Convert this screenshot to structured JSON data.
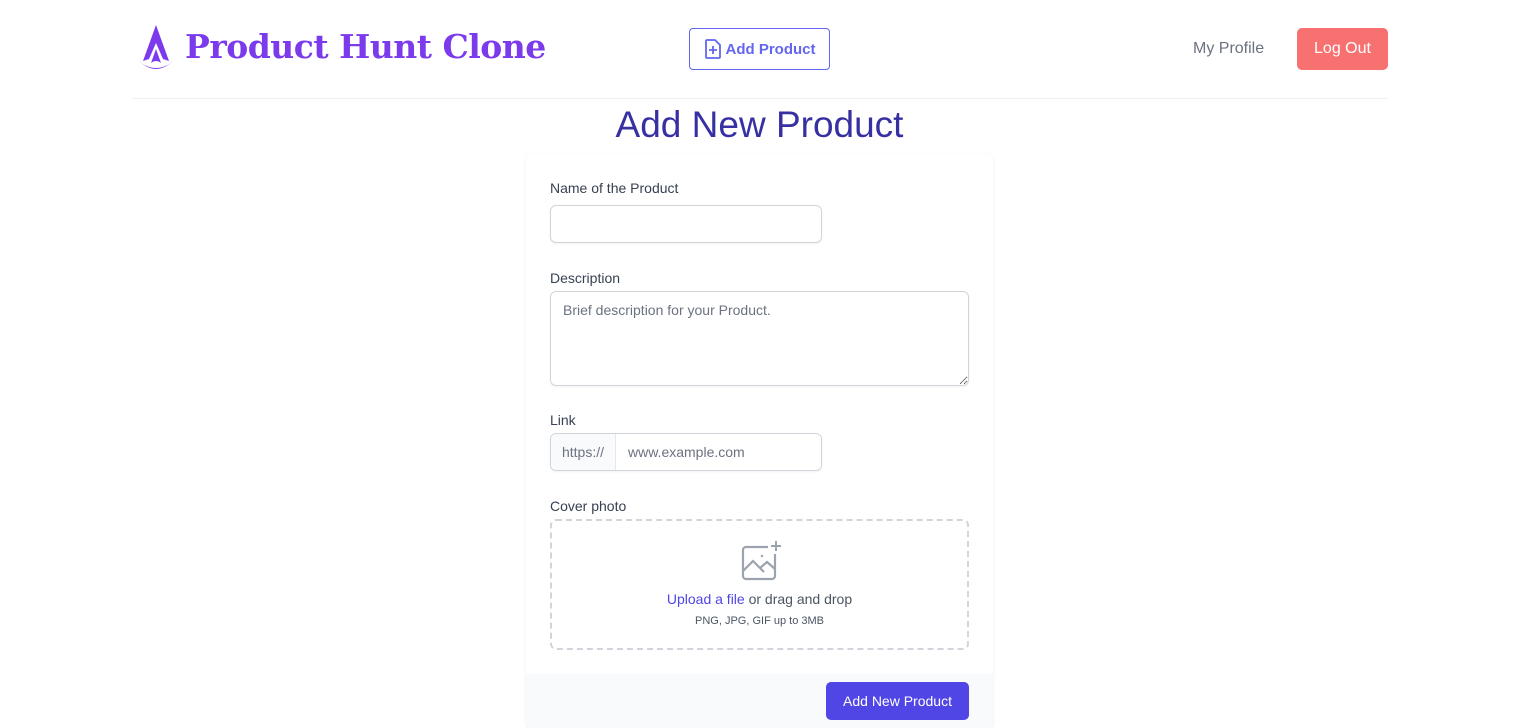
{
  "header": {
    "brand_title": "Product Hunt Clone",
    "logo_icon": "assassin-creed-logo-icon",
    "add_product_label": "Add Product",
    "add_product_icon": "document-plus-icon",
    "my_profile_label": "My Profile",
    "logout_label": "Log Out"
  },
  "page": {
    "title": "Add New Product"
  },
  "form": {
    "name_label": "Name of the Product",
    "name_value": "",
    "description_label": "Description",
    "description_placeholder": "Brief description for your Product.",
    "link_label": "Link",
    "link_prefix": "https://",
    "link_placeholder": "www.example.com",
    "cover_label": "Cover photo",
    "cover_icon": "image-plus-icon",
    "upload_link": "Upload a file",
    "drag_text": " or drag and drop",
    "upload_hint": "PNG, JPG, GIF up to 3MB",
    "submit_label": "Add New Product"
  },
  "colors": {
    "brand": "#7c3aed",
    "accent": "#6366f1",
    "primary_button": "#4f46e5",
    "logout": "#f87171",
    "title": "#3730a3"
  }
}
